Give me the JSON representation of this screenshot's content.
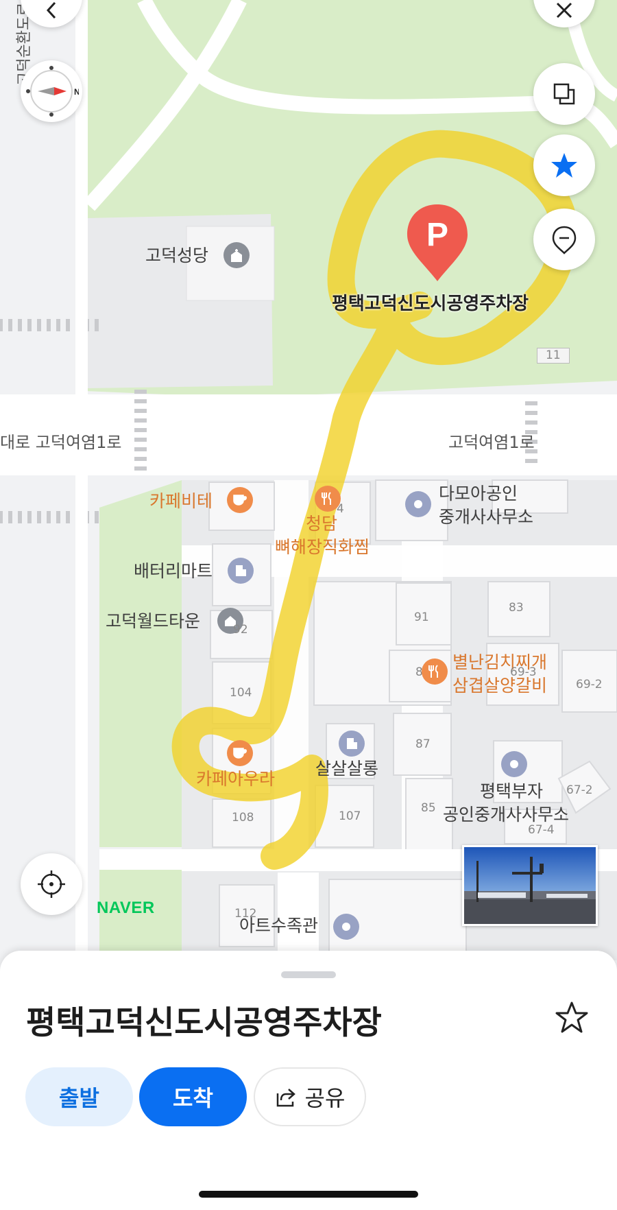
{
  "map": {
    "parking_pin_letter": "P",
    "parking_label": "평택고덕신도시공영주차장",
    "labels": {
      "godeok_cathedral": "고덕성당",
      "road_left": "대로 고덕여염1로",
      "road_right": "고덕여염1로",
      "cafe_bite": "카페비테",
      "cheongdam_1": "청담",
      "cheongdam_2": "뼈해장직화찜",
      "damoa_1": "다모아공인",
      "damoa_2": "중개사사무소",
      "battery_mart": "배터리마트",
      "godeok_world_town": "고덕월드타운",
      "byeolnan_1": "별난김치찌개",
      "byeolnan_2": "삼겹살양갈비",
      "cafe_aura": "카페아우라",
      "salsal_salon": "살살살롱",
      "pt_busa_1": "평택부자",
      "pt_busa_2": "공인중개사사무소",
      "art_aquarium": "아트수족관",
      "left_road_vertical": "고덕순환도로"
    },
    "numbers": {
      "n11": "11",
      "n4": "4",
      "n91": "91",
      "n83": "83",
      "n92": "92",
      "n104": "104",
      "n8": "8",
      "n69_3": "69-3",
      "n69_2": "69-2",
      "n87": "87",
      "n108": "108",
      "n107": "107",
      "n85": "85",
      "n67_2": "67-2",
      "n67_4": "67-4",
      "n112": "112"
    },
    "compass_letter": "N",
    "naver_logo": "NAVER",
    "highlight_color": "#f2d22c",
    "park_color": "#d9edc8",
    "road_color": "#ffffff",
    "icons": [
      "back-icon",
      "close-icon",
      "compass-icon",
      "layers-icon",
      "favorite-star-icon",
      "location-pin-icon",
      "my-location-icon"
    ]
  },
  "sheet": {
    "title": "평택고덕신도시공영주차장",
    "depart_label": "출발",
    "arrive_label": "도착",
    "share_label": "공유"
  }
}
